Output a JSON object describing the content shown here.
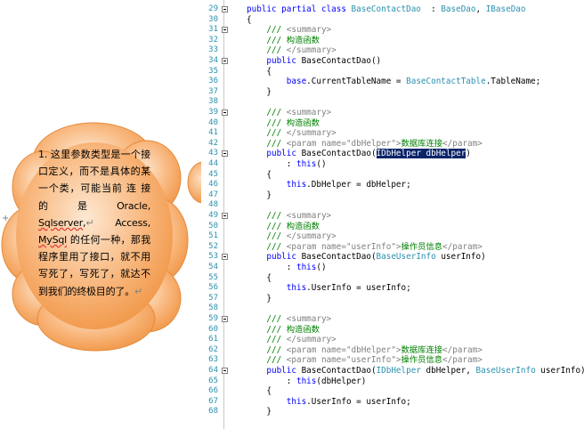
{
  "editor": {
    "lines": [
      {
        "n": "29",
        "segs": [
          [
            "kw",
            "public partial class "
          ],
          [
            "ty",
            "BaseContactDao"
          ],
          [
            "",
            "  : "
          ],
          [
            "ty",
            "BaseDao"
          ],
          [
            "",
            ", "
          ],
          [
            "ty",
            "IBaseDao"
          ]
        ]
      },
      {
        "n": "30",
        "segs": [
          [
            "",
            "{"
          ]
        ]
      },
      {
        "n": "31",
        "segs": [
          [
            "cm",
            "    /// "
          ],
          [
            "tg",
            "<summary>"
          ]
        ]
      },
      {
        "n": "32",
        "segs": [
          [
            "cm",
            "    /// 构造函数"
          ]
        ]
      },
      {
        "n": "33",
        "segs": [
          [
            "cm",
            "    /// "
          ],
          [
            "tg",
            "</summary>"
          ]
        ]
      },
      {
        "n": "34",
        "segs": [
          [
            "kw",
            "    public "
          ],
          [
            "",
            "BaseContactDao()"
          ]
        ]
      },
      {
        "n": "35",
        "segs": [
          [
            "",
            "    {"
          ]
        ]
      },
      {
        "n": "36",
        "segs": [
          [
            "kw",
            "        base"
          ],
          [
            "",
            ".CurrentTableName = "
          ],
          [
            "ty",
            "BaseContactTable"
          ],
          [
            "",
            ".TableName;"
          ]
        ]
      },
      {
        "n": "37",
        "segs": [
          [
            "",
            "    }"
          ]
        ]
      },
      {
        "n": "38",
        "segs": [
          [
            "",
            ""
          ]
        ]
      },
      {
        "n": "39",
        "segs": [
          [
            "cm",
            "    /// "
          ],
          [
            "tg",
            "<summary>"
          ]
        ]
      },
      {
        "n": "40",
        "segs": [
          [
            "cm",
            "    /// 构造函数"
          ]
        ]
      },
      {
        "n": "41",
        "segs": [
          [
            "cm",
            "    /// "
          ],
          [
            "tg",
            "</summary>"
          ]
        ]
      },
      {
        "n": "42",
        "segs": [
          [
            "cm",
            "    /// "
          ],
          [
            "tg",
            "<param name=\"dbHelper\">"
          ],
          [
            "cm",
            "数据库连接"
          ],
          [
            "tg",
            "</param>"
          ]
        ]
      },
      {
        "n": "43",
        "segs": [
          [
            "kw",
            "    public "
          ],
          [
            "",
            "BaseContactDao("
          ],
          [
            "sel",
            "IDbHelper dbHelper"
          ],
          [
            "",
            ")"
          ]
        ]
      },
      {
        "n": "44",
        "segs": [
          [
            "",
            "        : "
          ],
          [
            "kw",
            "this"
          ],
          [
            "",
            "()"
          ]
        ]
      },
      {
        "n": "45",
        "segs": [
          [
            "",
            "    {"
          ]
        ]
      },
      {
        "n": "46",
        "segs": [
          [
            "kw",
            "        this"
          ],
          [
            "",
            ".DbHelper = dbHelper;"
          ]
        ]
      },
      {
        "n": "47",
        "segs": [
          [
            "",
            "    }"
          ]
        ]
      },
      {
        "n": "48",
        "segs": [
          [
            "",
            ""
          ]
        ]
      },
      {
        "n": "49",
        "segs": [
          [
            "cm",
            "    /// "
          ],
          [
            "tg",
            "<summary>"
          ]
        ]
      },
      {
        "n": "50",
        "segs": [
          [
            "cm",
            "    /// 构造函数"
          ]
        ]
      },
      {
        "n": "51",
        "segs": [
          [
            "cm",
            "    /// "
          ],
          [
            "tg",
            "</summary>"
          ]
        ]
      },
      {
        "n": "52",
        "segs": [
          [
            "cm",
            "    /// "
          ],
          [
            "tg",
            "<param name=\"userInfo\">"
          ],
          [
            "cm",
            "操作员信息"
          ],
          [
            "tg",
            "</param>"
          ]
        ]
      },
      {
        "n": "53",
        "segs": [
          [
            "kw",
            "    public "
          ],
          [
            "",
            "BaseContactDao("
          ],
          [
            "ty",
            "BaseUserInfo"
          ],
          [
            "",
            " userInfo)"
          ]
        ]
      },
      {
        "n": "54",
        "segs": [
          [
            "",
            "        : "
          ],
          [
            "kw",
            "this"
          ],
          [
            "",
            "()"
          ]
        ]
      },
      {
        "n": "55",
        "segs": [
          [
            "",
            "    {"
          ]
        ]
      },
      {
        "n": "56",
        "segs": [
          [
            "kw",
            "        this"
          ],
          [
            "",
            ".UserInfo = userInfo;"
          ]
        ]
      },
      {
        "n": "57",
        "segs": [
          [
            "",
            "    }"
          ]
        ]
      },
      {
        "n": "58",
        "segs": [
          [
            "",
            ""
          ]
        ]
      },
      {
        "n": "59",
        "segs": [
          [
            "cm",
            "    /// "
          ],
          [
            "tg",
            "<summary>"
          ]
        ]
      },
      {
        "n": "60",
        "segs": [
          [
            "cm",
            "    /// 构造函数"
          ]
        ]
      },
      {
        "n": "61",
        "segs": [
          [
            "cm",
            "    /// "
          ],
          [
            "tg",
            "</summary>"
          ]
        ]
      },
      {
        "n": "62",
        "segs": [
          [
            "cm",
            "    /// "
          ],
          [
            "tg",
            "<param name=\"dbHelper\">"
          ],
          [
            "cm",
            "数据库连接"
          ],
          [
            "tg",
            "</param>"
          ]
        ]
      },
      {
        "n": "63",
        "segs": [
          [
            "cm",
            "    /// "
          ],
          [
            "tg",
            "<param name=\"userInfo\">"
          ],
          [
            "cm",
            "操作员信息"
          ],
          [
            "tg",
            "</param>"
          ]
        ]
      },
      {
        "n": "64",
        "segs": [
          [
            "kw",
            "    public "
          ],
          [
            "",
            "BaseContactDao("
          ],
          [
            "ty",
            "IDbHelper"
          ],
          [
            "",
            " dbHelper, "
          ],
          [
            "ty",
            "BaseUserInfo"
          ],
          [
            "",
            " userInfo)"
          ]
        ]
      },
      {
        "n": "65",
        "segs": [
          [
            "",
            "        : "
          ],
          [
            "kw",
            "this"
          ],
          [
            "",
            "(dbHelper)"
          ]
        ]
      },
      {
        "n": "66",
        "segs": [
          [
            "",
            "    {"
          ]
        ]
      },
      {
        "n": "67",
        "segs": [
          [
            "kw",
            "        this"
          ],
          [
            "",
            ".UserInfo = userInfo;"
          ]
        ]
      },
      {
        "n": "68",
        "segs": [
          [
            "",
            "    }"
          ]
        ]
      }
    ],
    "fold_markers": [
      "29",
      "31",
      "34",
      "39",
      "43",
      "49",
      "53",
      "59",
      "64"
    ]
  },
  "callout": {
    "text_parts": [
      [
        "",
        "1. 这里参数类型是一个接口定义，而不是具体的某一个类，可能当前 连 接 的 是 Oracle, "
      ],
      [
        "wavy",
        "Sqlserver"
      ],
      [
        "",
        ","
      ],
      [
        "pilcrow",
        "↵"
      ],
      [
        "",
        " Access, "
      ],
      [
        "wavy",
        "MySql"
      ],
      [
        "",
        " 的任何一种，那我程序里用了接口，就不用写死了，写死了，就达不到我们的终极目的了。"
      ],
      [
        "pilcrow",
        "↵"
      ]
    ],
    "fill_color": "#f59d4f",
    "fill_light": "#fde0c2"
  },
  "edge_mark": "+"
}
